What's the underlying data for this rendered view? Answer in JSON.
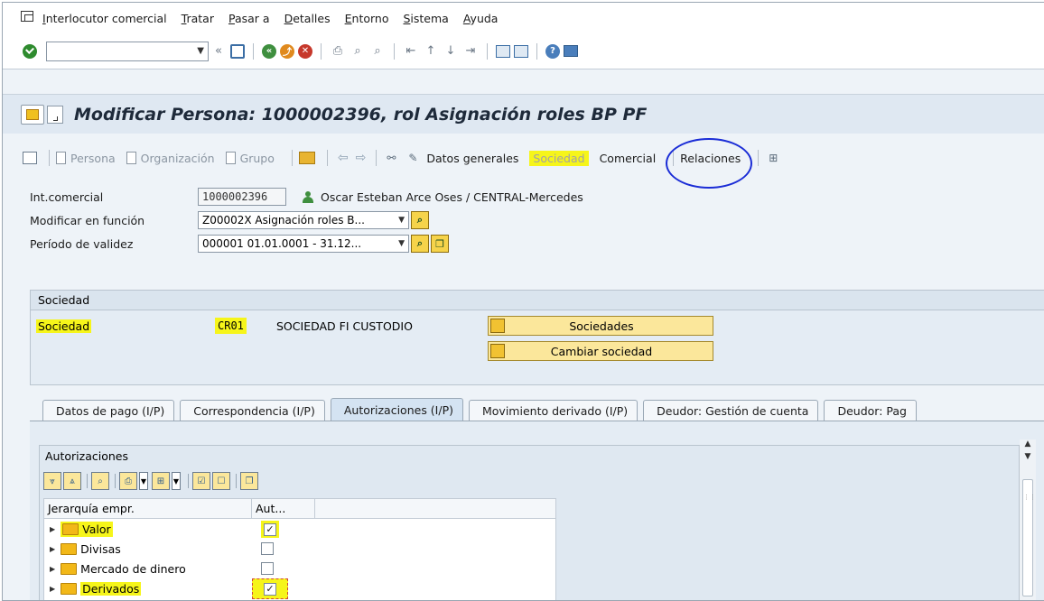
{
  "menubar": {
    "items": [
      {
        "underline": "I",
        "rest": "nterlocutor comercial"
      },
      {
        "underline": "T",
        "rest": "ratar"
      },
      {
        "underline": "P",
        "rest": "asar a"
      },
      {
        "underline": "D",
        "rest": "etalles"
      },
      {
        "underline": "E",
        "rest": "ntorno"
      },
      {
        "underline": "S",
        "rest": "istema"
      },
      {
        "underline": "A",
        "rest": "yuda"
      }
    ]
  },
  "systoolbar": {
    "command_value": "",
    "back_glyph": "«"
  },
  "title": {
    "text": "Modificar Persona: 1000002396, rol Asignación roles BP PF"
  },
  "apptoolbar": {
    "persona": "Persona",
    "organizacion": "Organización",
    "grupo": "Grupo",
    "datos_generales": "Datos generales",
    "sociedad": "Sociedad",
    "comercial": "Comercial",
    "relaciones": "Relaciones"
  },
  "header": {
    "int_comercial_label": "Int.comercial",
    "int_comercial_value": "1000002396",
    "person_name": "Oscar Esteban Arce Oses / CENTRAL-Mercedes",
    "modificar_label": "Modificar en función",
    "modificar_value": "Z00002X Asignación roles B...",
    "periodo_label": "Período de validez",
    "periodo_value": "000001 01.01.0001 - 31.12..."
  },
  "sociedad_group": {
    "title": "Sociedad",
    "label": "Sociedad",
    "code": "CR01",
    "name": "SOCIEDAD FI CUSTODIO",
    "btn_sociedades": "Sociedades",
    "btn_cambiar": "Cambiar sociedad"
  },
  "tabs": [
    {
      "label": "Datos de pago (I/P)",
      "active": false
    },
    {
      "label": "Correspondencia (I/P)",
      "active": false
    },
    {
      "label": "Autorizaciones (I/P)",
      "active": true
    },
    {
      "label": "Movimiento derivado (I/P)",
      "active": false
    },
    {
      "label": "Deudor: Gestión de cuenta",
      "active": false
    },
    {
      "label": "Deudor: Pag",
      "active": false
    }
  ],
  "autorizaciones": {
    "title": "Autorizaciones",
    "col_hierarchy": "Jerarquía empr.",
    "col_aut": "Aut...",
    "rows": [
      {
        "label": "Valor",
        "checked": true,
        "highlight": true
      },
      {
        "label": "Divisas",
        "checked": false,
        "highlight": false
      },
      {
        "label": "Mercado de dinero",
        "checked": false,
        "highlight": false
      },
      {
        "label": "Derivados",
        "checked": true,
        "highlight": true
      }
    ]
  },
  "colors": {
    "highlight": "#f6f51a",
    "annotation": "#1a2cd6",
    "folder": "#f2b818"
  }
}
